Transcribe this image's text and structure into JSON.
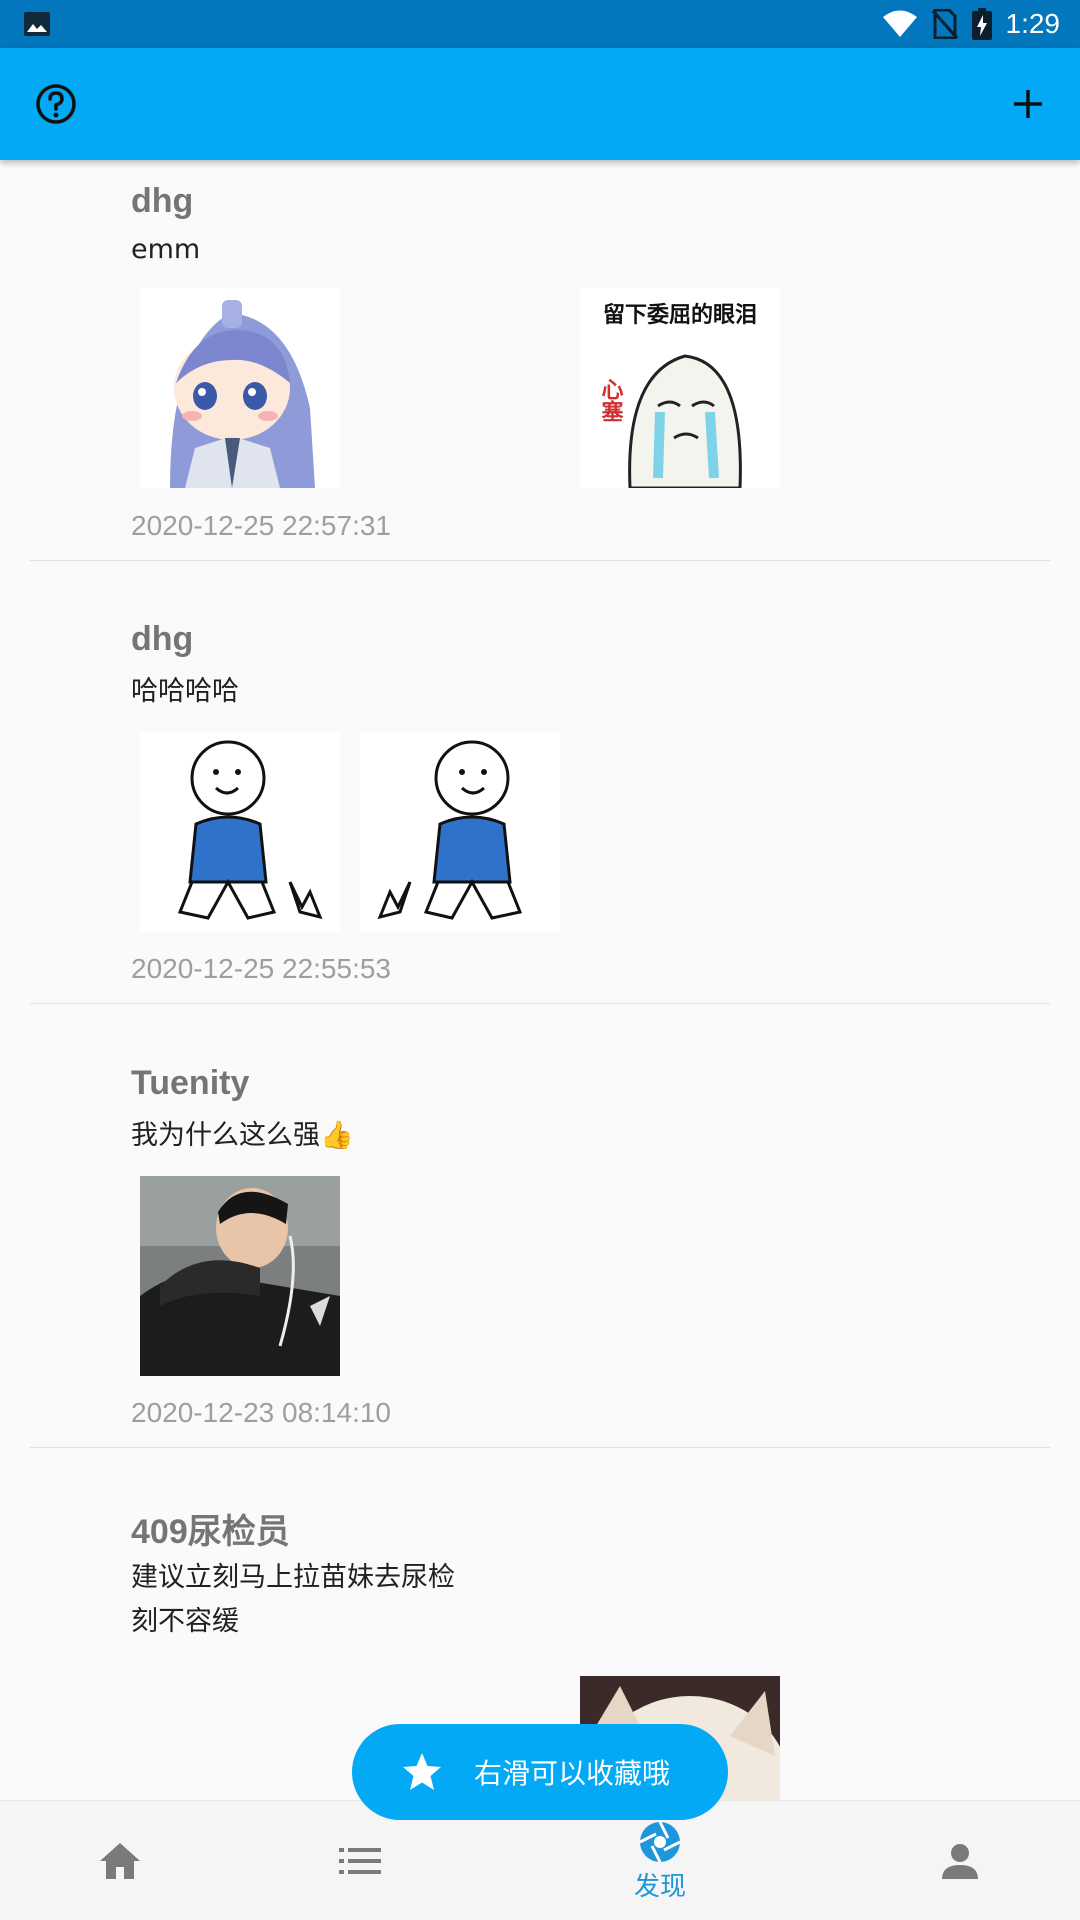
{
  "status_bar": {
    "time": "1:29"
  },
  "app_bar": {
    "help_icon": "help-circle-icon",
    "add_icon": "plus-icon"
  },
  "posts": [
    {
      "author": "dhg",
      "content": "emm",
      "time": "2020-12-25 22:57:31",
      "images": [
        "anime-boy-sticker",
        "crying-meme-sticker"
      ],
      "image_text": {
        "caption": "留下委屈的眼泪",
        "side": "心塞"
      }
    },
    {
      "author": "dhg",
      "content": "哈哈哈哈",
      "time": "2020-12-25 22:55:53",
      "images": [
        "kneeling-guy-sticker",
        "kneeling-guy-sticker-mirrored"
      ]
    },
    {
      "author": "Tuenity",
      "content": "我为什么这么强👍",
      "time": "2020-12-23 08:14:10",
      "images": [
        "person-photo"
      ]
    },
    {
      "author": "409尿检员",
      "content": "建议立刻马上拉苗妹去尿检\n刻不容缓",
      "time": "",
      "images": [
        "cat-photo"
      ]
    }
  ],
  "toast": {
    "icon": "star-icon",
    "message": "右滑可以收藏哦"
  },
  "bottom_nav": {
    "items": [
      {
        "icon": "home-icon",
        "label": ""
      },
      {
        "icon": "list-icon",
        "label": ""
      },
      {
        "icon": "aperture-icon",
        "label": "发现",
        "active": true
      },
      {
        "icon": "person-icon",
        "label": ""
      }
    ],
    "active_color": "#1e96dc"
  },
  "colors": {
    "status_bar": "#0277bd",
    "app_bar": "#03a9f4",
    "accent": "#03a9f4"
  }
}
